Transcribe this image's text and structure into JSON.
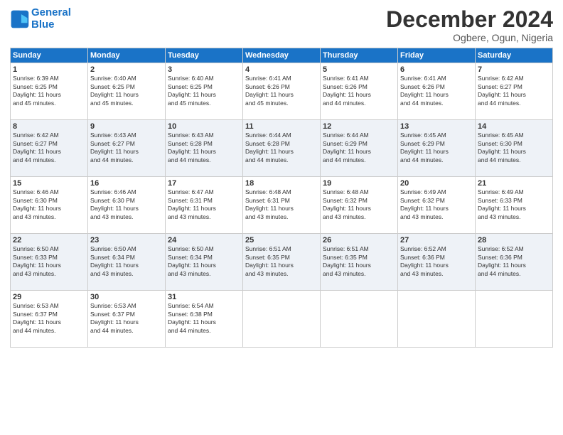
{
  "header": {
    "logo_line1": "General",
    "logo_line2": "Blue",
    "month": "December 2024",
    "location": "Ogbere, Ogun, Nigeria"
  },
  "weekdays": [
    "Sunday",
    "Monday",
    "Tuesday",
    "Wednesday",
    "Thursday",
    "Friday",
    "Saturday"
  ],
  "weeks": [
    [
      {
        "day": "1",
        "info": "Sunrise: 6:39 AM\nSunset: 6:25 PM\nDaylight: 11 hours\nand 45 minutes."
      },
      {
        "day": "2",
        "info": "Sunrise: 6:40 AM\nSunset: 6:25 PM\nDaylight: 11 hours\nand 45 minutes."
      },
      {
        "day": "3",
        "info": "Sunrise: 6:40 AM\nSunset: 6:25 PM\nDaylight: 11 hours\nand 45 minutes."
      },
      {
        "day": "4",
        "info": "Sunrise: 6:41 AM\nSunset: 6:26 PM\nDaylight: 11 hours\nand 45 minutes."
      },
      {
        "day": "5",
        "info": "Sunrise: 6:41 AM\nSunset: 6:26 PM\nDaylight: 11 hours\nand 44 minutes."
      },
      {
        "day": "6",
        "info": "Sunrise: 6:41 AM\nSunset: 6:26 PM\nDaylight: 11 hours\nand 44 minutes."
      },
      {
        "day": "7",
        "info": "Sunrise: 6:42 AM\nSunset: 6:27 PM\nDaylight: 11 hours\nand 44 minutes."
      }
    ],
    [
      {
        "day": "8",
        "info": "Sunrise: 6:42 AM\nSunset: 6:27 PM\nDaylight: 11 hours\nand 44 minutes."
      },
      {
        "day": "9",
        "info": "Sunrise: 6:43 AM\nSunset: 6:27 PM\nDaylight: 11 hours\nand 44 minutes."
      },
      {
        "day": "10",
        "info": "Sunrise: 6:43 AM\nSunset: 6:28 PM\nDaylight: 11 hours\nand 44 minutes."
      },
      {
        "day": "11",
        "info": "Sunrise: 6:44 AM\nSunset: 6:28 PM\nDaylight: 11 hours\nand 44 minutes."
      },
      {
        "day": "12",
        "info": "Sunrise: 6:44 AM\nSunset: 6:29 PM\nDaylight: 11 hours\nand 44 minutes."
      },
      {
        "day": "13",
        "info": "Sunrise: 6:45 AM\nSunset: 6:29 PM\nDaylight: 11 hours\nand 44 minutes."
      },
      {
        "day": "14",
        "info": "Sunrise: 6:45 AM\nSunset: 6:30 PM\nDaylight: 11 hours\nand 44 minutes."
      }
    ],
    [
      {
        "day": "15",
        "info": "Sunrise: 6:46 AM\nSunset: 6:30 PM\nDaylight: 11 hours\nand 43 minutes."
      },
      {
        "day": "16",
        "info": "Sunrise: 6:46 AM\nSunset: 6:30 PM\nDaylight: 11 hours\nand 43 minutes."
      },
      {
        "day": "17",
        "info": "Sunrise: 6:47 AM\nSunset: 6:31 PM\nDaylight: 11 hours\nand 43 minutes."
      },
      {
        "day": "18",
        "info": "Sunrise: 6:48 AM\nSunset: 6:31 PM\nDaylight: 11 hours\nand 43 minutes."
      },
      {
        "day": "19",
        "info": "Sunrise: 6:48 AM\nSunset: 6:32 PM\nDaylight: 11 hours\nand 43 minutes."
      },
      {
        "day": "20",
        "info": "Sunrise: 6:49 AM\nSunset: 6:32 PM\nDaylight: 11 hours\nand 43 minutes."
      },
      {
        "day": "21",
        "info": "Sunrise: 6:49 AM\nSunset: 6:33 PM\nDaylight: 11 hours\nand 43 minutes."
      }
    ],
    [
      {
        "day": "22",
        "info": "Sunrise: 6:50 AM\nSunset: 6:33 PM\nDaylight: 11 hours\nand 43 minutes."
      },
      {
        "day": "23",
        "info": "Sunrise: 6:50 AM\nSunset: 6:34 PM\nDaylight: 11 hours\nand 43 minutes."
      },
      {
        "day": "24",
        "info": "Sunrise: 6:50 AM\nSunset: 6:34 PM\nDaylight: 11 hours\nand 43 minutes."
      },
      {
        "day": "25",
        "info": "Sunrise: 6:51 AM\nSunset: 6:35 PM\nDaylight: 11 hours\nand 43 minutes."
      },
      {
        "day": "26",
        "info": "Sunrise: 6:51 AM\nSunset: 6:35 PM\nDaylight: 11 hours\nand 43 minutes."
      },
      {
        "day": "27",
        "info": "Sunrise: 6:52 AM\nSunset: 6:36 PM\nDaylight: 11 hours\nand 43 minutes."
      },
      {
        "day": "28",
        "info": "Sunrise: 6:52 AM\nSunset: 6:36 PM\nDaylight: 11 hours\nand 44 minutes."
      }
    ],
    [
      {
        "day": "29",
        "info": "Sunrise: 6:53 AM\nSunset: 6:37 PM\nDaylight: 11 hours\nand 44 minutes."
      },
      {
        "day": "30",
        "info": "Sunrise: 6:53 AM\nSunset: 6:37 PM\nDaylight: 11 hours\nand 44 minutes."
      },
      {
        "day": "31",
        "info": "Sunrise: 6:54 AM\nSunset: 6:38 PM\nDaylight: 11 hours\nand 44 minutes."
      },
      {
        "day": "",
        "info": ""
      },
      {
        "day": "",
        "info": ""
      },
      {
        "day": "",
        "info": ""
      },
      {
        "day": "",
        "info": ""
      }
    ]
  ]
}
